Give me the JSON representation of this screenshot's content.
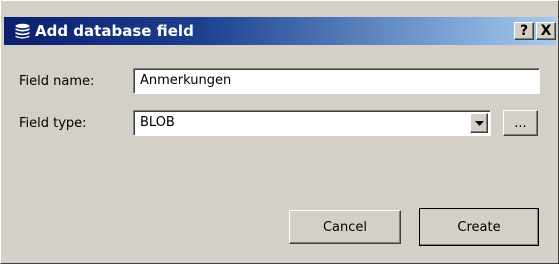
{
  "window": {
    "title": "Add database field",
    "help_label": "?",
    "close_label": "X"
  },
  "form": {
    "field_name_label": "Field name:",
    "field_name_value": "Anmerkungen",
    "field_type_label": "Field type:",
    "field_type_value": "BLOB",
    "browse_label": "..."
  },
  "buttons": {
    "cancel_label": "Cancel",
    "create_label": "Create"
  },
  "icons": {
    "title_icon": "database-icon",
    "dropdown_icon": "chevron-down-icon"
  },
  "colors": {
    "dialog_bg": "#d4d0c8",
    "titlebar_start": "#0b1f6e",
    "titlebar_end": "#a6caf0"
  }
}
